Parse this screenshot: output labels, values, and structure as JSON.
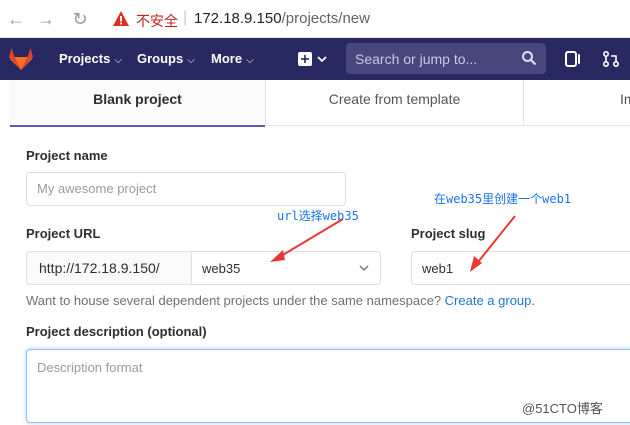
{
  "browser": {
    "insecure_label": "不安全",
    "url_host": "172.18.9.150",
    "url_path": "/projects/new"
  },
  "navbar": {
    "projects": "Projects",
    "groups": "Groups",
    "more": "More",
    "search_placeholder": "Search or jump to..."
  },
  "tabs": [
    {
      "label": "Blank project",
      "active": true
    },
    {
      "label": "Create from template",
      "active": false
    },
    {
      "label": "Imp",
      "active": false
    }
  ],
  "form": {
    "project_name_label": "Project name",
    "project_name_placeholder": "My awesome project",
    "project_url_label": "Project URL",
    "url_prefix": "http://172.18.9.150/",
    "namespace_value": "web35",
    "project_slug_label": "Project slug",
    "project_slug_value": "web1",
    "help_text": "Want to house several dependent projects under the same namespace? ",
    "help_link": "Create a group.",
    "description_label": "Project description (optional)",
    "description_placeholder": "Description format"
  },
  "annotations": {
    "url_note": "url选择web35",
    "slug_note": "在web35里创建一个web1"
  },
  "watermark": "@51CTO博客",
  "colors": {
    "navbar": "#292961",
    "tab_active_underline": "#6b4fbb",
    "link": "#1f78d1",
    "annotation": "#1a73e8",
    "arrow": "#e53935"
  }
}
